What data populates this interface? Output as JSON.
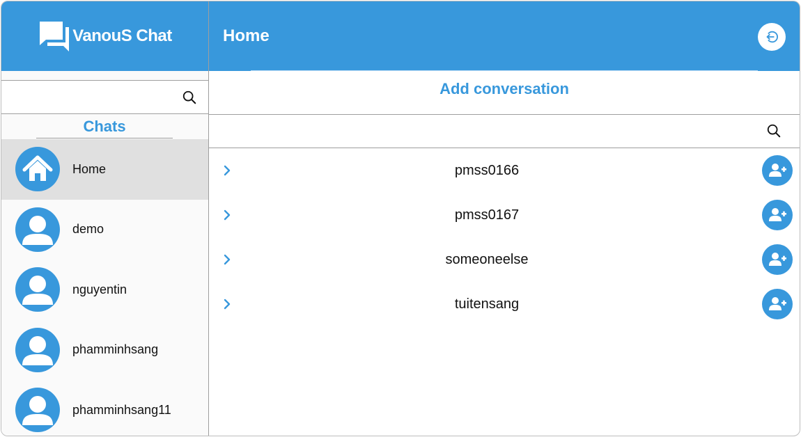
{
  "brand": {
    "name": "VanouS Chat",
    "logo_icon": "chat-bubbles-icon"
  },
  "sidebar": {
    "search": {
      "value": "",
      "placeholder": "",
      "icon": "search-icon"
    },
    "chats_title": "Chats",
    "items": [
      {
        "label": "Home",
        "icon": "home-icon",
        "active": true
      },
      {
        "label": "demo",
        "icon": "user-avatar-icon"
      },
      {
        "label": "nguyentin",
        "icon": "user-avatar-icon"
      },
      {
        "label": "phamminhsang",
        "icon": "user-avatar-icon"
      },
      {
        "label": "phamminhsang11",
        "icon": "user-avatar-icon"
      }
    ]
  },
  "header": {
    "title": "Home",
    "logout_icon": "logout-icon"
  },
  "main": {
    "add_conversation_title": "Add conversation",
    "search": {
      "value": "",
      "placeholder": "",
      "icon": "search-icon"
    },
    "users": [
      {
        "name": "pmss0166"
      },
      {
        "name": "pmss0167"
      },
      {
        "name": "someoneelse"
      },
      {
        "name": "tuitensang"
      }
    ]
  },
  "colors": {
    "primary": "#3898dc",
    "active_item": "#e0e0e0",
    "sidebar_bg": "#fafafa",
    "border": "#9e9e9e"
  }
}
